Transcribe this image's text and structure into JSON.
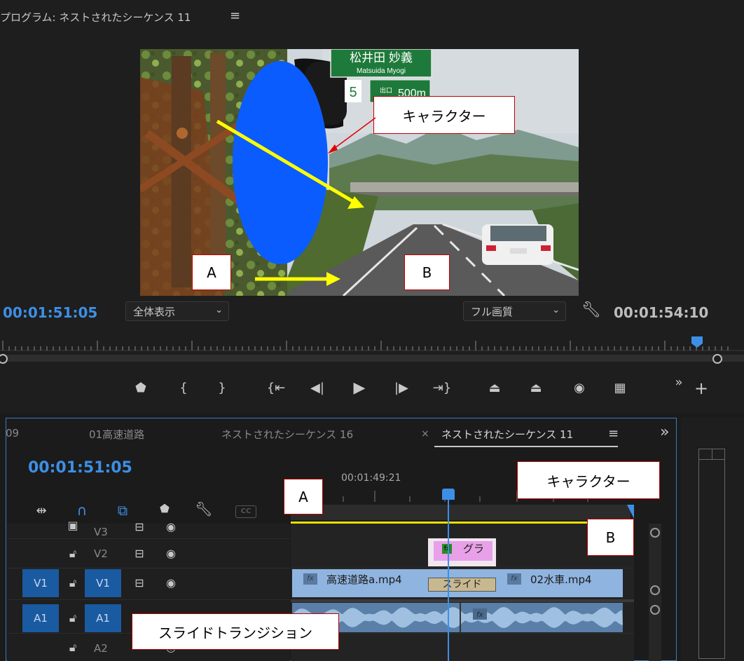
{
  "program_monitor": {
    "title": "プログラム: ネストされたシーケンス 11",
    "menu_icon": "≡",
    "current_timecode": "00:01:51:05",
    "zoom_select": "全体表示",
    "quality_select": "フル画質",
    "duration_timecode": "00:01:54:10",
    "video": {
      "sign_kanji": "松井田  妙義",
      "sign_romaji": "Matsuida    Myogi",
      "sign_number": "5",
      "sign_exit": "出口",
      "sign_distance": "500m"
    },
    "controls": [
      "marker-icon",
      "mark-in-icon",
      "mark-out-icon",
      "go-to-in-icon",
      "step-back-icon",
      "play-icon",
      "step-forward-icon",
      "go-to-out-icon",
      "lift-icon",
      "extract-icon",
      "export-frame-icon",
      "comparison-view-icon",
      "more-icon",
      "add-button-icon"
    ]
  },
  "callouts": {
    "monitor_character": "キャラクター",
    "monitor_a": "A",
    "monitor_b": "B",
    "timeline_a": "A",
    "timeline_character": "キャラクター",
    "timeline_b": "B",
    "transition": "スライドトランジション"
  },
  "timeline": {
    "tabs": [
      "09",
      "01高速道路",
      "ネストされたシーケンス 16",
      "ネストされたシーケンス 11"
    ],
    "close_icon": "×",
    "menu_icon": "≡",
    "overflow_icon": "»",
    "current_timecode": "00:01:51:05",
    "ruler_timecode": "00:01:49:21",
    "cc_label": "CC",
    "tracks": {
      "v3": "V3",
      "v2": "V2",
      "v1_source": "V1",
      "v1": "V1",
      "a1_source": "A1",
      "a1": "A1",
      "a2": "A2"
    },
    "clips": {
      "v2_clip": "グラ",
      "v1_clip_a": "高速道路a.mp4",
      "v1_clip_b": "02水車.mp4",
      "transition_label": "スライド",
      "fx_badge": "fx"
    }
  },
  "colors": {
    "accent_blue": "#3d8fe6",
    "callout_border": "#c00000",
    "clip_video": "#8fb4df",
    "clip_graphic": "#e8a0e8",
    "character_shape": "#0b5cff",
    "arrow_yellow": "#ffff00"
  }
}
